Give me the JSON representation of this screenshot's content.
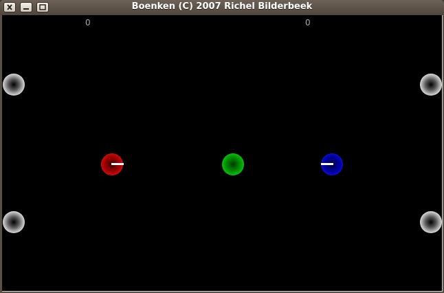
{
  "window": {
    "title": "Boenken (C) 2007 Richel Bilderbeek",
    "buttons": [
      "close-icon",
      "minimize-icon",
      "maximize-icon"
    ]
  },
  "game": {
    "scores": {
      "left": "0",
      "right": "0"
    },
    "colors": {
      "background": "#000000",
      "player1": "#ff0000",
      "ball": "#00ff00",
      "player2": "#0000ff",
      "obstacle": "#ffffff"
    },
    "objects": [
      "obstacle",
      "obstacle",
      "obstacle",
      "obstacle",
      "player-red",
      "ball-green",
      "player-blue"
    ]
  }
}
